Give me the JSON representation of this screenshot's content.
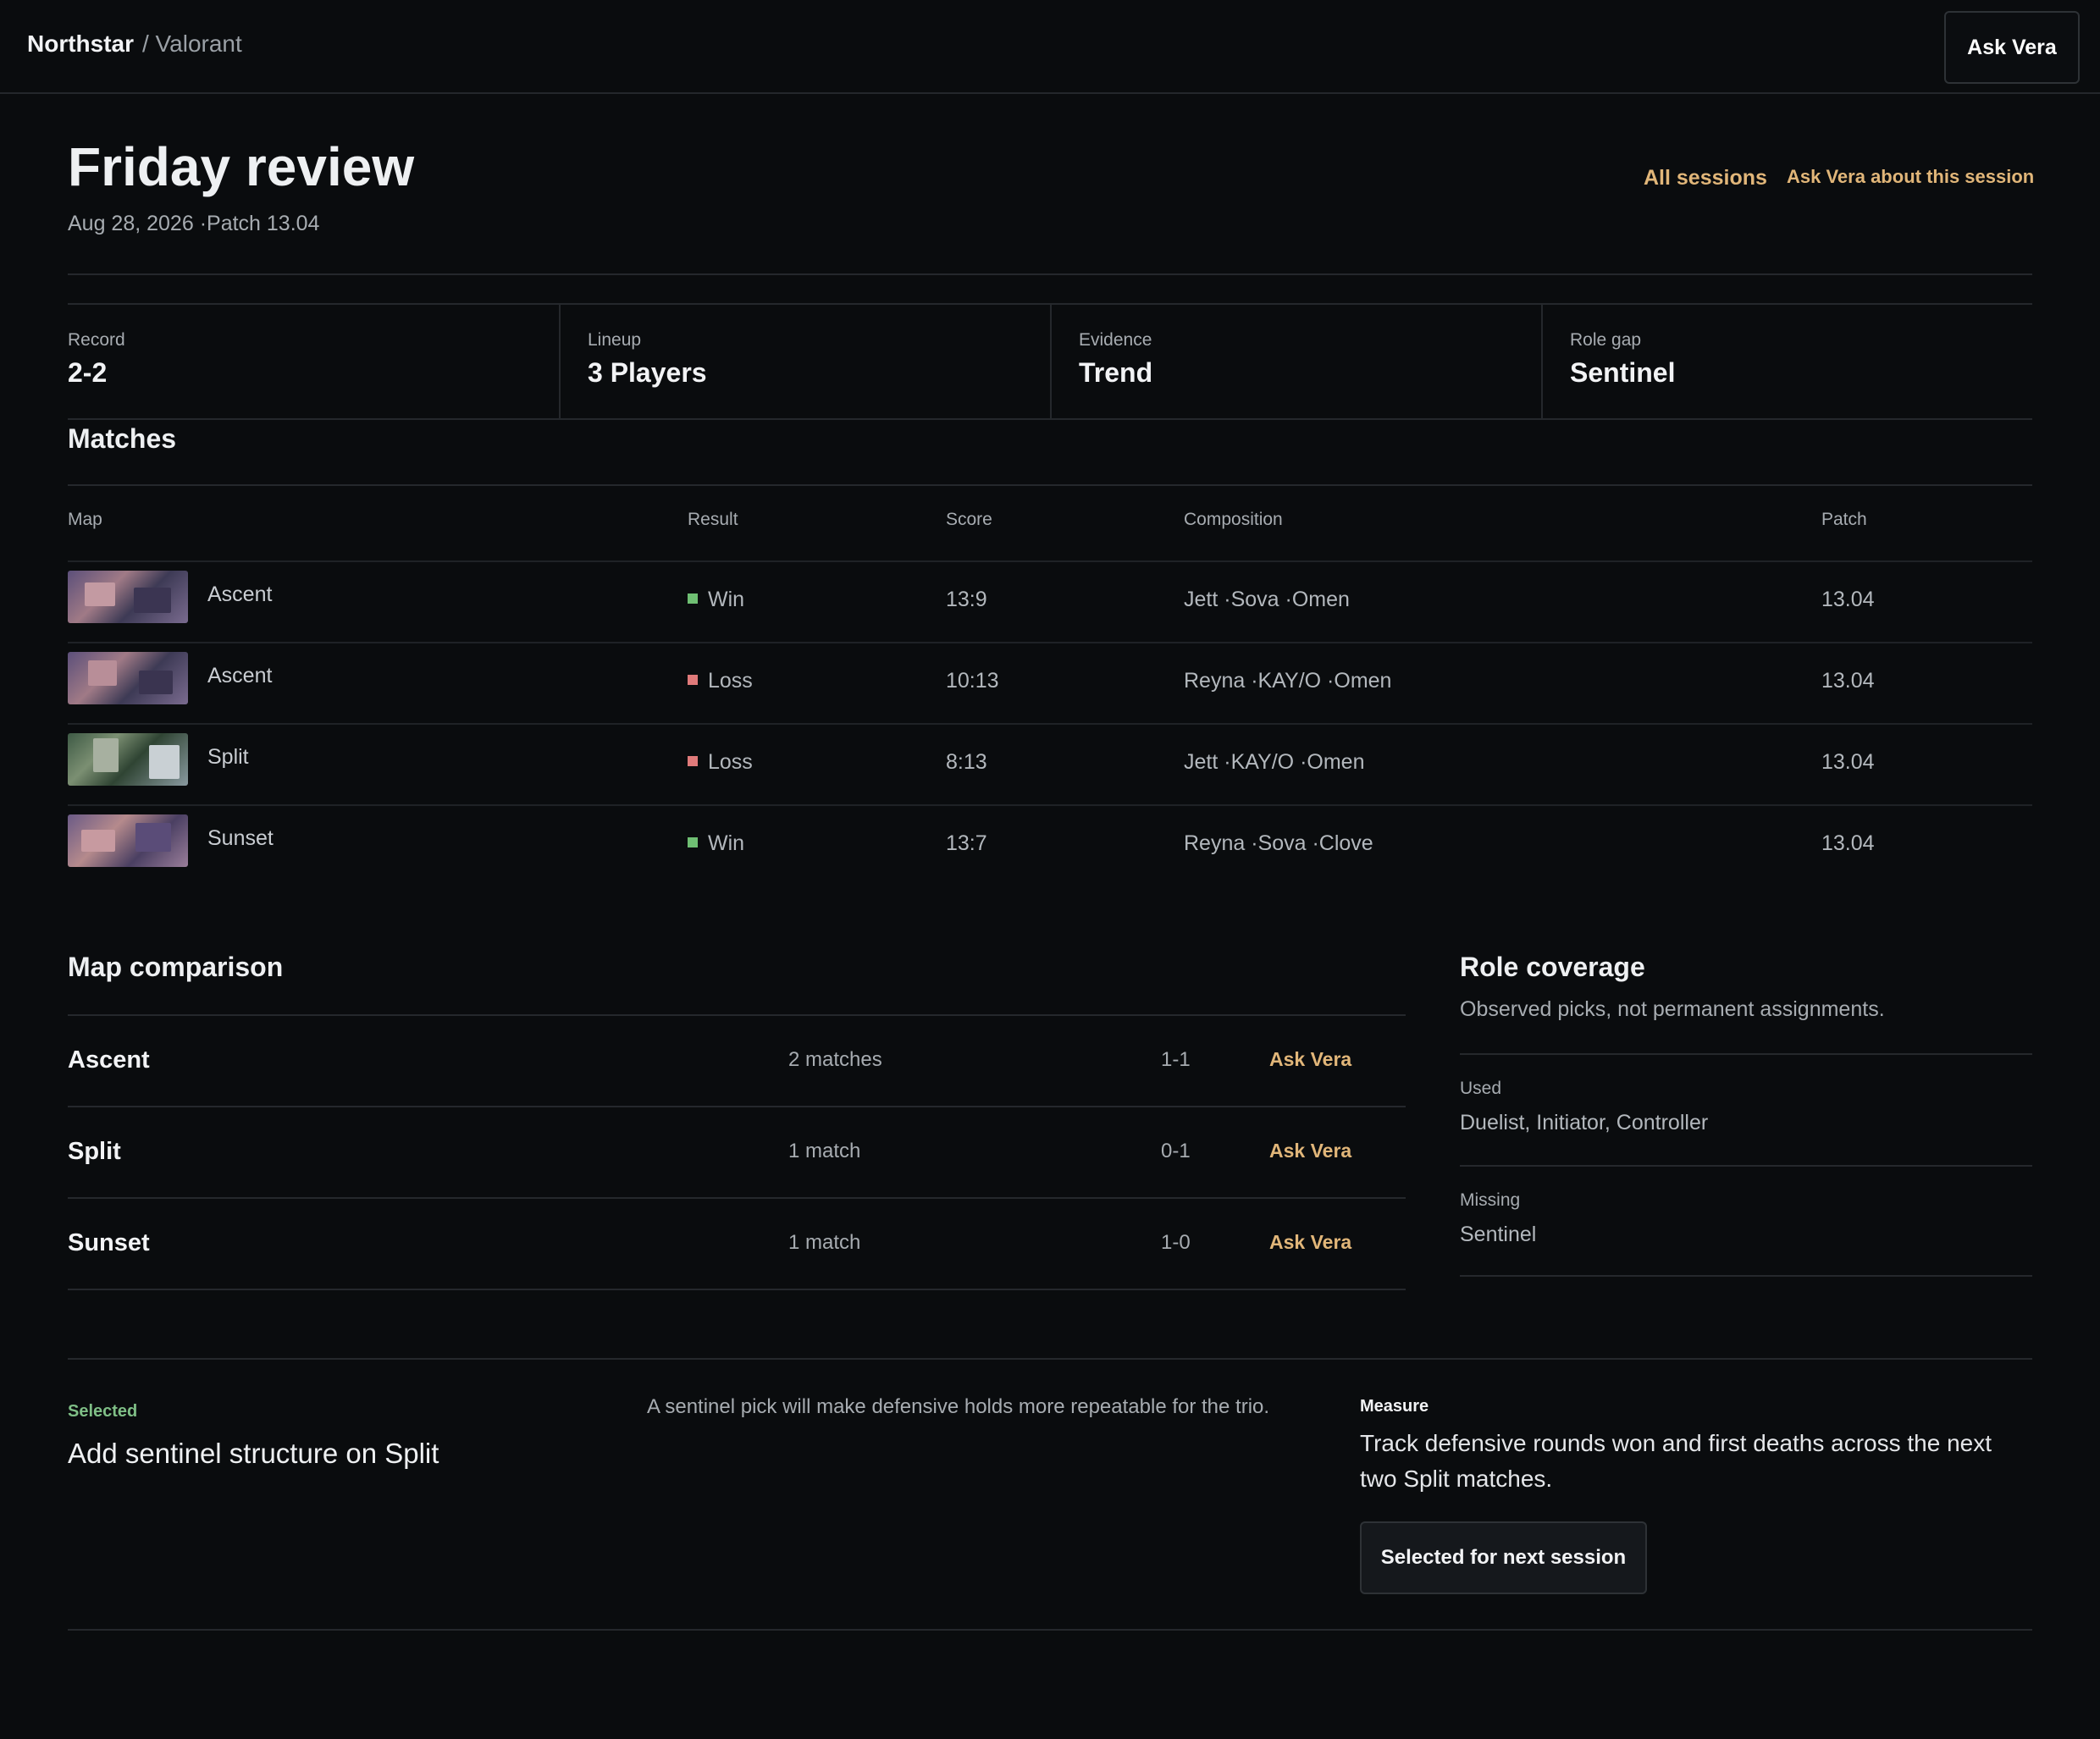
{
  "header": {
    "brand": "Northstar",
    "crumb": "/ Valorant",
    "ask_label": "Ask Vera"
  },
  "session": {
    "title": "Friday review",
    "meta": "Aug 28, 2026 ·Patch 13.04",
    "all_sessions_label": "All sessions",
    "ask_session_label": "Ask Vera about this session"
  },
  "stats": [
    {
      "label": "Record",
      "value": "2-2"
    },
    {
      "label": "Lineup",
      "value": "3 Players"
    },
    {
      "label": "Evidence",
      "value": "Trend"
    },
    {
      "label": "Role gap",
      "value": "Sentinel"
    }
  ],
  "matches": {
    "title": "Matches",
    "columns": {
      "map": "Map",
      "result": "Result",
      "score": "Score",
      "composition": "Composition",
      "patch": "Patch"
    },
    "rows": [
      {
        "map": "Ascent",
        "result": "Win",
        "score": "13:9",
        "composition": "Jett ·Sova ·Omen",
        "patch": "13.04"
      },
      {
        "map": "Ascent",
        "result": "Loss",
        "score": "10:13",
        "composition": "Reyna ·KAY/O ·Omen",
        "patch": "13.04"
      },
      {
        "map": "Split",
        "result": "Loss",
        "score": "8:13",
        "composition": "Jett ·KAY/O ·Omen",
        "patch": "13.04"
      },
      {
        "map": "Sunset",
        "result": "Win",
        "score": "13:7",
        "composition": "Reyna ·Sova ·Clove",
        "patch": "13.04"
      }
    ]
  },
  "comparison": {
    "title": "Map comparison",
    "rows": [
      {
        "map": "Ascent",
        "matches": "2 matches",
        "record": "1-1",
        "ask": "Ask Vera"
      },
      {
        "map": "Split",
        "matches": "1 match",
        "record": "0-1",
        "ask": "Ask Vera"
      },
      {
        "map": "Sunset",
        "matches": "1 match",
        "record": "1-0",
        "ask": "Ask Vera"
      }
    ]
  },
  "roles": {
    "title": "Role coverage",
    "subtitle": "Observed picks, not permanent assignments.",
    "used_label": "Used",
    "used_value": "Duelist, Initiator, Controller",
    "missing_label": "Missing",
    "missing_value": "Sentinel"
  },
  "selection": {
    "tag": "Selected",
    "title": "Add sentinel structure on Split",
    "description": "A sentinel pick will make defensive holds more repeatable for the trio.",
    "measure_label": "Measure",
    "measure_text": "Track defensive rounds won and first deaths across the next two Split matches.",
    "button_label": "Selected for next session"
  },
  "colors": {
    "background": "#0a0c0e",
    "accent_gold": "#e1b679",
    "win": "#6fbf73",
    "loss": "#e07a7a",
    "selected_green": "#7fbf86"
  }
}
